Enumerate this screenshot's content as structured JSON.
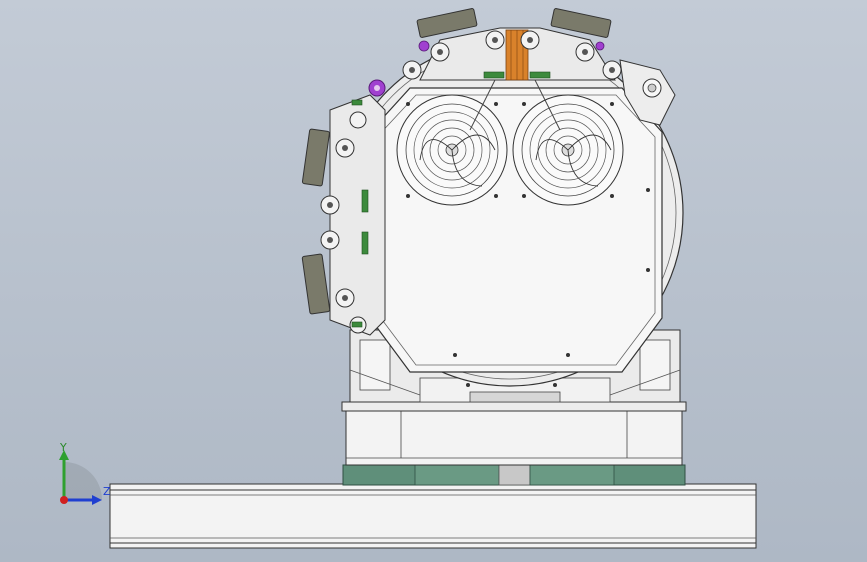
{
  "triad": {
    "y_label": "Y",
    "z_label": "Z",
    "y_color": "#2fa02f",
    "z_color": "#1f3fd0",
    "x_color": "#d02020"
  },
  "colors": {
    "background_top": "#c3cbd6",
    "background_bottom": "#aeb8c5",
    "part_fill": "#f4f4f4",
    "part_shade": "#dcdcdc",
    "line": "#3a3a3a",
    "pad_green": "#5f8f7a",
    "accent_orange": "#d9822b",
    "accent_purple": "#a040d0",
    "accent_green": "#3c8a3c",
    "pad_grey": "#7a7a6a"
  }
}
